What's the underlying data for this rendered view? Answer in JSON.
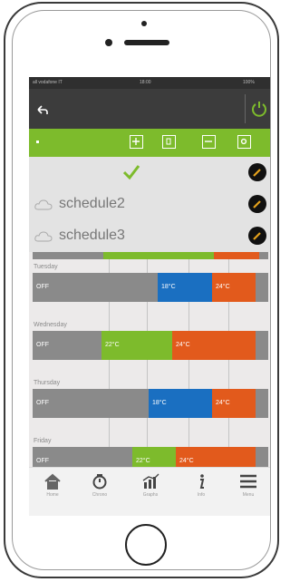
{
  "statusbar": {
    "carrier": "all vodafone IT",
    "time": "18:00",
    "battery": "100%"
  },
  "dropdown": {
    "items": [
      {
        "label": "",
        "selected": true
      },
      {
        "label": "schedule2",
        "selected": false
      },
      {
        "label": "schedule3",
        "selected": false
      }
    ]
  },
  "schedules": [
    {
      "day": "Tuesday",
      "segments": [
        {
          "label": "OFF",
          "color": "#8a8a8a"
        },
        {
          "label": "18°C",
          "color": "#1a6fc1"
        },
        {
          "label": "24°C",
          "color": "#e25a1c"
        },
        {
          "label": "",
          "color": "#8a8a8a"
        }
      ]
    },
    {
      "day": "Wednesday",
      "segments": [
        {
          "label": "OFF",
          "color": "#8a8a8a"
        },
        {
          "label": "22°C",
          "color": "#7dbb2c"
        },
        {
          "label": "24°C",
          "color": "#e25a1c"
        },
        {
          "label": "",
          "color": "#8a8a8a"
        }
      ]
    },
    {
      "day": "Thursday",
      "segments": [
        {
          "label": "OFF",
          "color": "#8a8a8a"
        },
        {
          "label": "18°C",
          "color": "#1a6fc1"
        },
        {
          "label": "24°C",
          "color": "#e25a1c"
        },
        {
          "label": "",
          "color": "#8a8a8a"
        }
      ]
    },
    {
      "day": "Friday",
      "segments": [
        {
          "label": "OFF",
          "color": "#8a8a8a"
        },
        {
          "label": "22°C",
          "color": "#7dbb2c"
        },
        {
          "label": "24°C",
          "color": "#e25a1c"
        },
        {
          "label": "",
          "color": "#8a8a8a"
        }
      ]
    }
  ],
  "tabs": [
    {
      "label": "Home",
      "icon": "home-icon"
    },
    {
      "label": "Chrono",
      "icon": "chrono-icon"
    },
    {
      "label": "Graphs",
      "icon": "graphs-icon"
    },
    {
      "label": "Info",
      "icon": "info-icon"
    },
    {
      "label": "Menu",
      "icon": "menu-icon"
    }
  ],
  "colors": {
    "green": "#7dbb2c",
    "blue": "#1a6fc1",
    "orange": "#e25a1c",
    "grey": "#8a8a8a",
    "navbar": "#3c3c3c"
  }
}
